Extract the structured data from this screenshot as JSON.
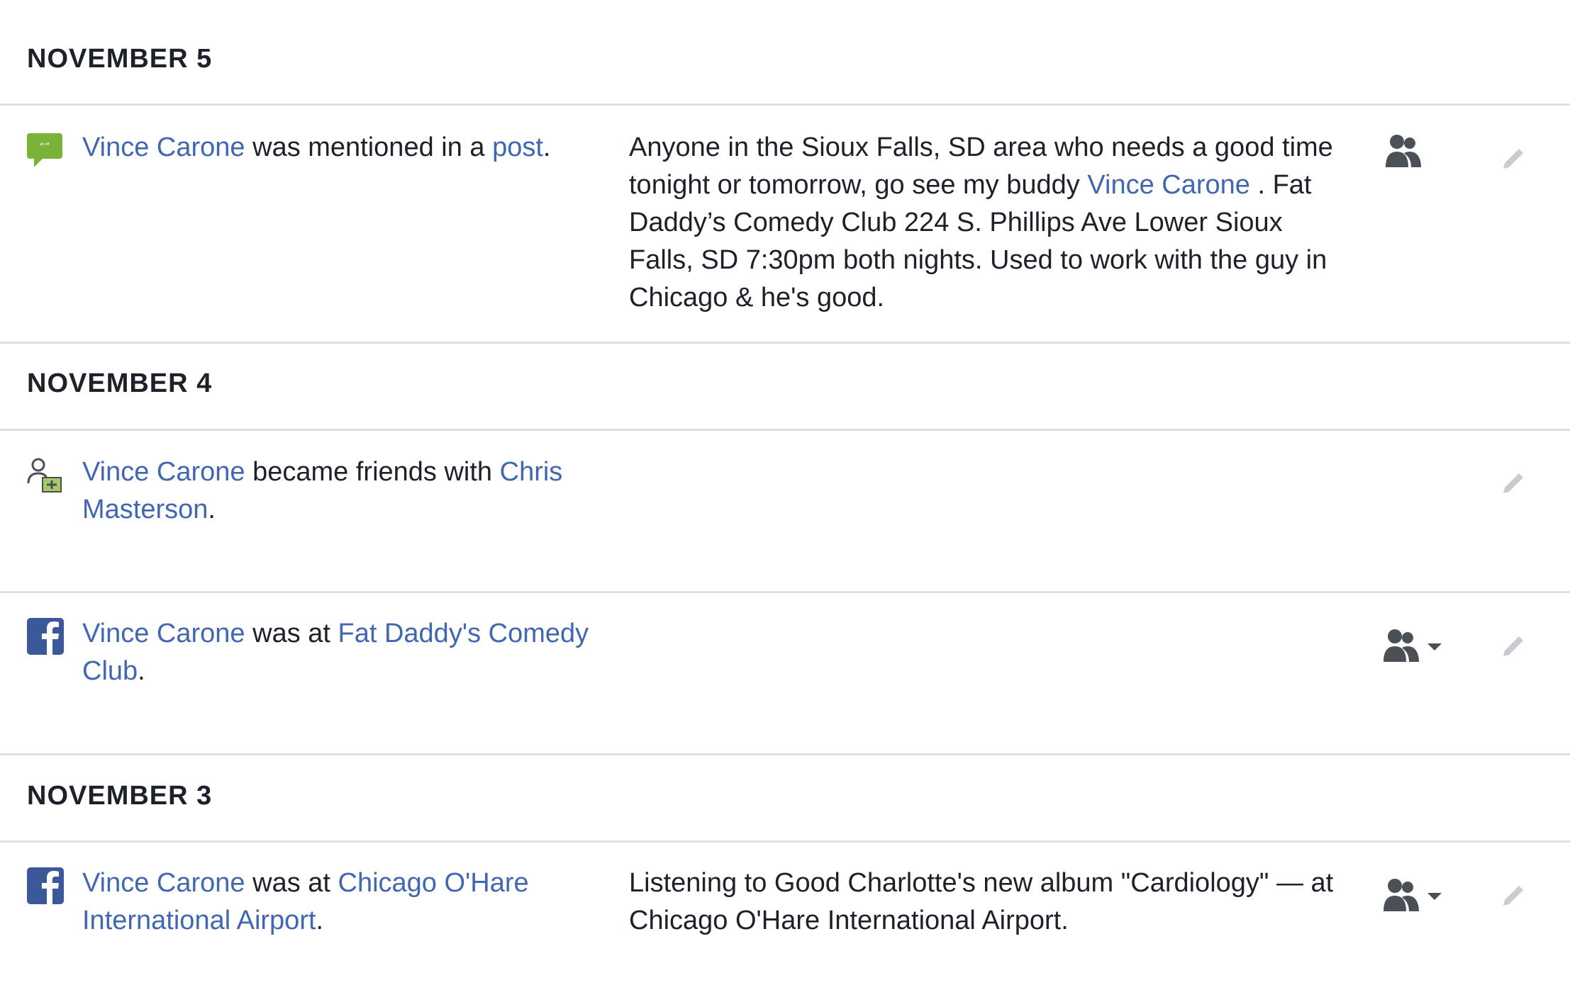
{
  "sections": [
    {
      "date": "NOVEMBER 5",
      "entries": [
        {
          "icon": "speech-bubble-icon",
          "actor": "Vince Carone",
          "text_1": " was mentioned in a ",
          "link_2": "post",
          "end": ".",
          "content": {
            "p1": "Anyone in the Sioux Falls, SD area who needs a good time tonight or tomorrow, go see my buddy ",
            "mention": "Vince Carone",
            "p2": " . Fat Daddy’s Comedy Club 224 S. Phillips Ave Lower Sioux Falls, SD 7:30pm both nights. Used to work with the guy in Chicago & he's good."
          },
          "audience": "friends-icon"
        }
      ]
    },
    {
      "date": "NOVEMBER 4",
      "entries": [
        {
          "icon": "friend-add-icon",
          "actor": "Vince Carone",
          "text_1": " became friends with ",
          "link_2": "Chris Masterson",
          "end": "."
        },
        {
          "icon": "facebook-icon",
          "actor": "Vince Carone",
          "text_1": " was at ",
          "link_2": "Fat Daddy's Comedy Club",
          "end": ".",
          "audience": "friends-dropdown-icon"
        }
      ]
    },
    {
      "date": "NOVEMBER 3",
      "entries": [
        {
          "icon": "facebook-icon",
          "actor": "Vince Carone",
          "text_1": " was at ",
          "link_2": "Chicago O'Hare International Airport",
          "end": ".",
          "content": {
            "p1": "Listening to Good Charlotte's new album \"Cardiology\" — at Chicago O'Hare International Airport."
          },
          "audience": "friends-dropdown-icon"
        }
      ]
    }
  ],
  "colors": {
    "link": "#4267b2",
    "text": "#1d2129",
    "divider": "#dddfe2",
    "facebook_blue": "#3b5998",
    "mention_green": "#7bb33a",
    "icon_gray": "#4b4f56",
    "pencil_gray": "#c8cbd0"
  }
}
